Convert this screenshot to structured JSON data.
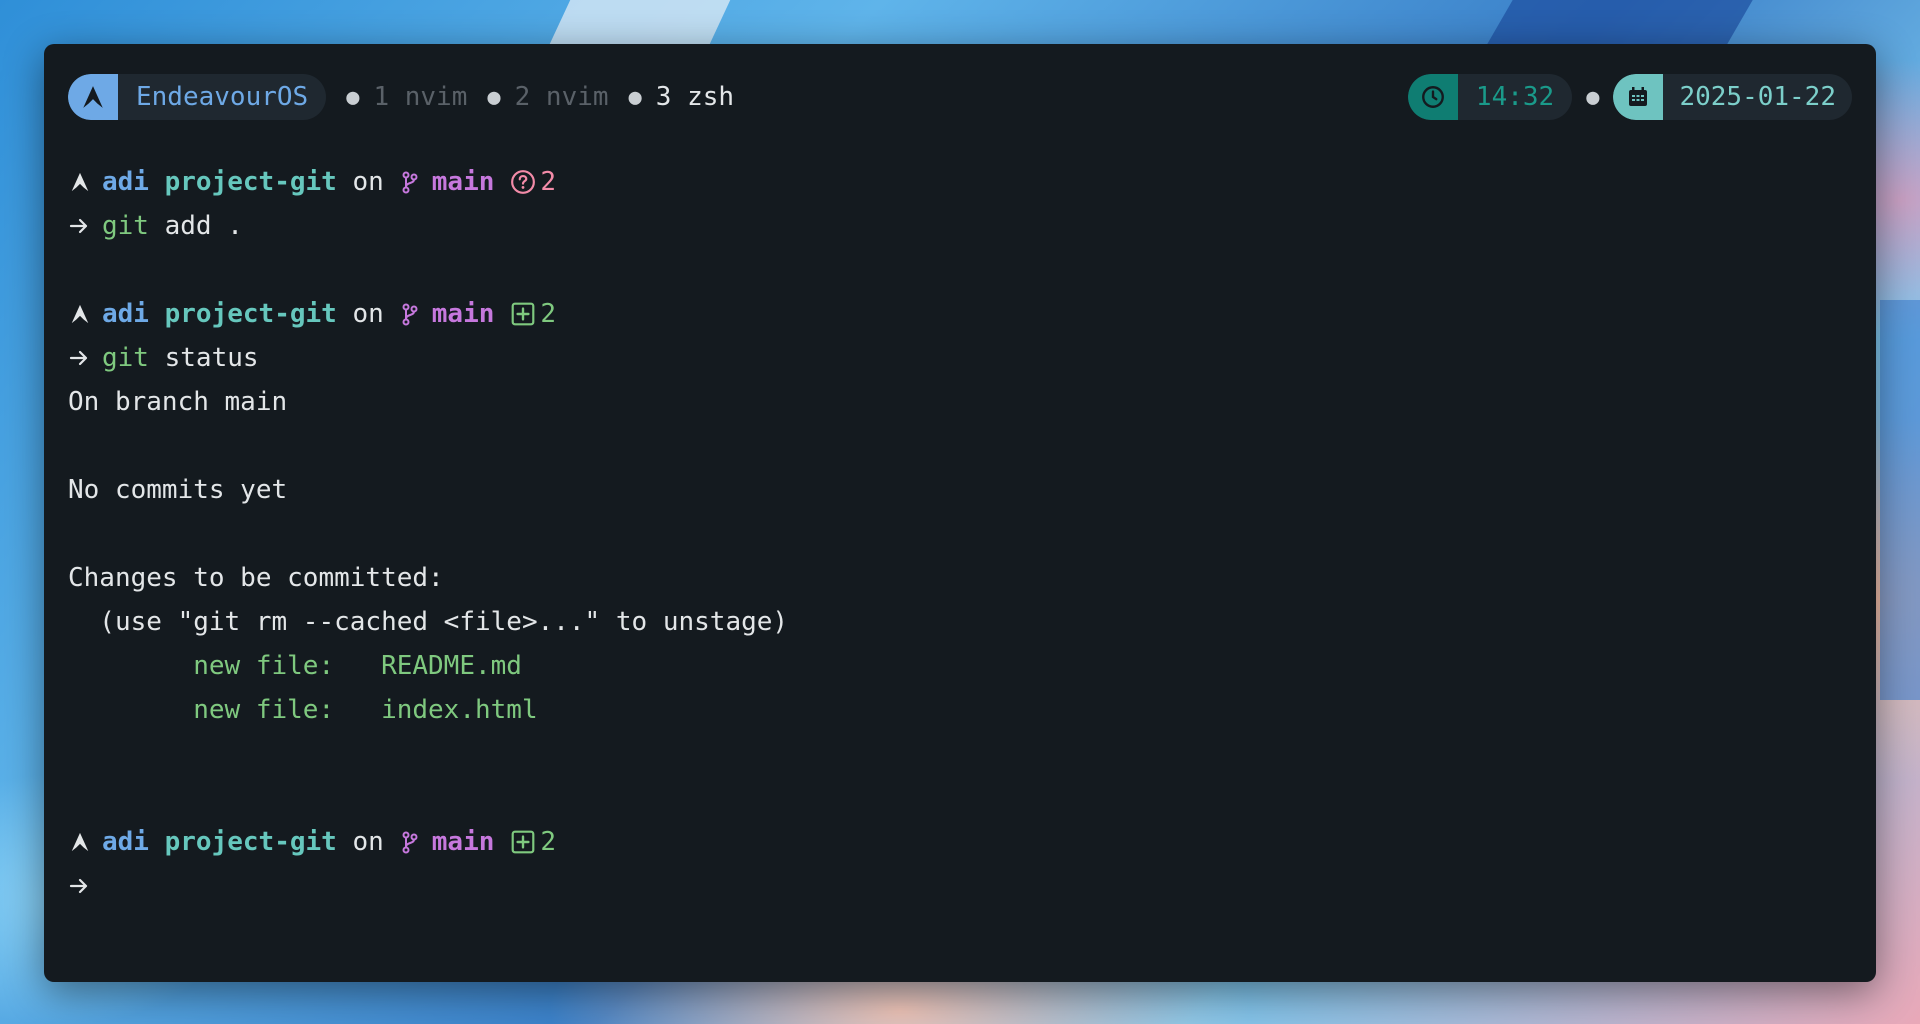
{
  "window": {
    "background_color": "#141a1f"
  },
  "topbar": {
    "os_name": "EndeavourOS",
    "os_icon": "arch-logo-icon",
    "workspaces": [
      {
        "label": "1 nvim",
        "active": false
      },
      {
        "label": "2 nvim",
        "active": false
      },
      {
        "label": "3 zsh",
        "active": true
      }
    ],
    "time": "14:32",
    "time_icon": "clock-icon",
    "date": "2025-01-22",
    "date_icon": "calendar-icon"
  },
  "colors": {
    "accent_blue": "#6ea9e6",
    "teal": "#66c7bd",
    "branch_purple": "#c678dd",
    "git_green": "#7fc97f",
    "untracked_pink": "#f38ba8"
  },
  "terminal": {
    "prompts": [
      {
        "user": "adi",
        "dir": "project-git",
        "on": "on",
        "branch": "main",
        "status_icon": "question-circle-icon",
        "status_count": "2",
        "command_name": "git",
        "command_args": " add ."
      },
      {
        "user": "adi",
        "dir": "project-git",
        "on": "on",
        "branch": "main",
        "status_icon": "plus-square-icon",
        "status_count": "2",
        "command_name": "git",
        "command_args": " status"
      },
      {
        "user": "adi",
        "dir": "project-git",
        "on": "on",
        "branch": "main",
        "status_icon": "plus-square-icon",
        "status_count": "2",
        "command_name": "",
        "command_args": ""
      }
    ],
    "output": {
      "line1": "On branch main",
      "line2": "No commits yet",
      "line3": "Changes to be committed:",
      "line4": "  (use \"git rm --cached <file>...\" to unstage)",
      "files": [
        {
          "label": "        new file:   README.md"
        },
        {
          "label": "        new file:   index.html"
        }
      ]
    }
  }
}
